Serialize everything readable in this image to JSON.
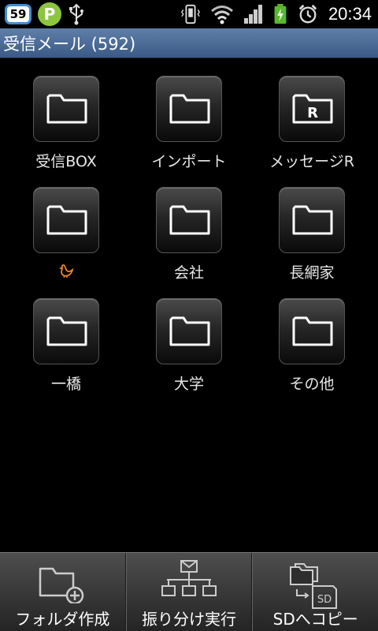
{
  "status_bar": {
    "notification_count": "59",
    "p_app_letter": "P",
    "time": "20:34"
  },
  "title_bar": {
    "title": "受信メール (592)"
  },
  "folders": [
    {
      "label": "受信BOX",
      "icon": "folder-icon"
    },
    {
      "label": "インポート",
      "icon": "folder-icon"
    },
    {
      "label": "メッセージR",
      "icon": "folder-r-icon",
      "badge": "R"
    },
    {
      "label": "",
      "icon": "folder-icon",
      "label_icon": "bird-icon",
      "label_icon_color": "#e8842a"
    },
    {
      "label": "会社",
      "icon": "folder-icon"
    },
    {
      "label": "長網家",
      "icon": "folder-icon"
    },
    {
      "label": "一橋",
      "icon": "folder-icon"
    },
    {
      "label": "大学",
      "icon": "folder-icon"
    },
    {
      "label": "その他",
      "icon": "folder-icon"
    }
  ],
  "toolbar": {
    "create_folder_label": "フォルダ作成",
    "sort_label": "振り分け実行",
    "copy_sd_label": "SDへコピー",
    "sd_icon_text": "SD"
  },
  "colors": {
    "title_bar_accent": "#4a6a96",
    "badge_border": "#3d8ed6",
    "p_app_green": "#8cc63f",
    "battery_green": "#5ab82e",
    "bird_orange": "#e8842a"
  }
}
